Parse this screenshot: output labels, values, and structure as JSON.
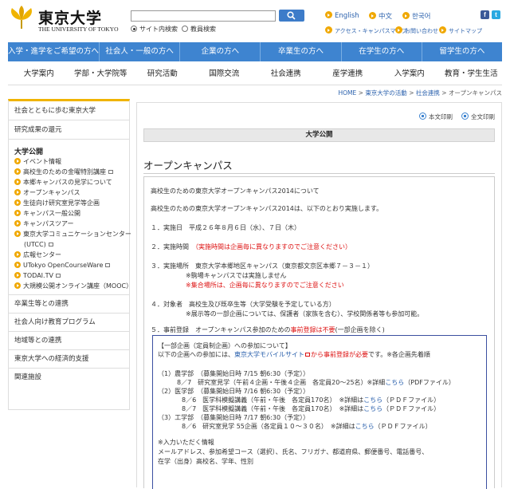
{
  "header": {
    "logo_jp": "東京大学",
    "logo_en": "THE UNIVERSITY OF TOKYO",
    "search": {
      "value": "",
      "placeholder": ""
    },
    "radio_site": "サイト内検索",
    "radio_faculty": "教員検索",
    "lang": [
      "English",
      "中文",
      "한국어"
    ],
    "sub": [
      "アクセス・キャンパスマップ",
      "お問い合わせ",
      "サイトマップ"
    ],
    "social": {
      "facebook": "f",
      "twitter": "t"
    }
  },
  "bluenav": [
    "入学・進学をご希望の方へ",
    "社会人・一般の方へ",
    "企業の方へ",
    "卒業生の方へ",
    "在学生の方へ",
    "留学生の方へ"
  ],
  "graynav": [
    "大学案内",
    "学部・大学院等",
    "研究活動",
    "国際交流",
    "社会連携",
    "産学連携",
    "入学案内",
    "教育・学生生活"
  ],
  "breadcrumb": {
    "home": "HOME",
    "sep": " > ",
    "l1": "東京大学の活動",
    "l2": "社会連携",
    "current": "オープンキャンパス"
  },
  "sidebar": {
    "top": [
      "社会とともに歩む東京大学",
      "研究成果の還元"
    ],
    "head": "大学公開",
    "items": [
      {
        "label": "イベント情報",
        "ext": false,
        "indent": false
      },
      {
        "label": "高校生のための金曜特別講座",
        "ext": true,
        "indent": false
      },
      {
        "label": "本郷キャンパスの見学について",
        "ext": false,
        "indent": false
      },
      {
        "label": "オープンキャンパス",
        "ext": false,
        "indent": false
      },
      {
        "label": "生徒向け研究室見学等企画",
        "ext": false,
        "indent": false
      },
      {
        "label": "キャンパス一般公開",
        "ext": false,
        "indent": false
      },
      {
        "label": "キャンパスツアー",
        "ext": false,
        "indent": false
      },
      {
        "label": "東京大学コミュニケーションセンター",
        "ext": false,
        "indent": false
      },
      {
        "label": "(UTCC)",
        "ext": true,
        "indent": true
      },
      {
        "label": "広報センター",
        "ext": false,
        "indent": false
      },
      {
        "label": "UTokyo OpenCourseWare",
        "ext": true,
        "indent": false
      },
      {
        "label": "TODAI.TV",
        "ext": true,
        "indent": false
      },
      {
        "label": "大規模公開オンライン講座（MOOC）",
        "ext": false,
        "indent": false
      }
    ],
    "sections": [
      "卒業生等との連携",
      "社会人向け教育プログラム",
      "地域等との連携",
      "東京大学への経済的支援",
      "関連施設"
    ]
  },
  "main": {
    "print_text": "本文印刷",
    "print_all": "全文印刷",
    "section": "大学公開",
    "title": "オープンキャンパス",
    "intro": "高校生のための東京大学オープンキャンパス2014について",
    "intro2": "高校生のための東京大学オープンキャンパス2014は、以下のとおり実施します。",
    "date_label": "１．実施日　平成２６年８月６日（水）、７日（木）",
    "time_label": "２．実施時間　",
    "time_note": "（実施時間は企画毎に異なりますのでご注意ください）",
    "place_label": "３．実施場所　東京大学本郷地区キャンパス（東京都文京区本郷７－３－１）",
    "place_note1": "※駒場キャンパスでは実施しません",
    "place_note2": "※集合場所は、企画毎に異なりますのでご注意ください",
    "target_label": "４．対象者　高校生及び既卒生等（大学受験を予定している方）",
    "target_note": "※展示等の一部企画については、保護者（家族を含む）、学校関係者等も参加可能。",
    "reg_label": "５．事前登録　オープンキャンパス参加のための",
    "reg_red": "事前登録は不要",
    "reg_tail": "(一部企画を除く)",
    "box": {
      "head": "【一部企画（定員制企画）への参加について】",
      "l2a": "以下の企画への参加には、",
      "l2b": "東京大学モバイルサイト",
      "l2c": "から事前登録が必要",
      "l2d": "です。※各企画先着順",
      "r1": "（1）農学部　（募集開始日時 7/15  朝6:30（予定））",
      "r2a": "8／7　研究室見学（午前４企画・午後４企画　各定員20～25名）※詳細",
      "r2b": "こちら",
      "r2c": "（PDFファイル）",
      "r3": "（2）医学部　（募集開始日時 7/16  朝6:30（予定））",
      "r4a": "8／6　医学科模擬講義（午前・午後　各定員170名）　※詳細は",
      "r4b": "こちら",
      "r4c": "（ＰＤＦファイル）",
      "r5a": "8／7　医学科模擬講義（午前・午後　各定員170名）　※詳細は",
      "r5b": "こちら",
      "r5c": "（ＰＤＦファイル）",
      "r6": "（3）工学部　（募集開始日時 7/17  朝6:30（予定））",
      "r7a": "8／6　研究室見学 55企画（各定員１０～３０名）　※詳細は",
      "r7b": "こちら",
      "r7c": "（ＰＤＦファイル）",
      "r8": "※入力いただく情報",
      "r9": "メールアドレス、参加希望コース（選択）、氏名、フリガナ、都道府県、郵便番号、電話番号、",
      "r10": "在学（出身）高校名、学年、性別"
    }
  },
  "colors": {
    "accent_blue": "#3e84d0",
    "accent_yellow": "#f0b400",
    "link": "#2b61ad",
    "alert": "#d11"
  }
}
